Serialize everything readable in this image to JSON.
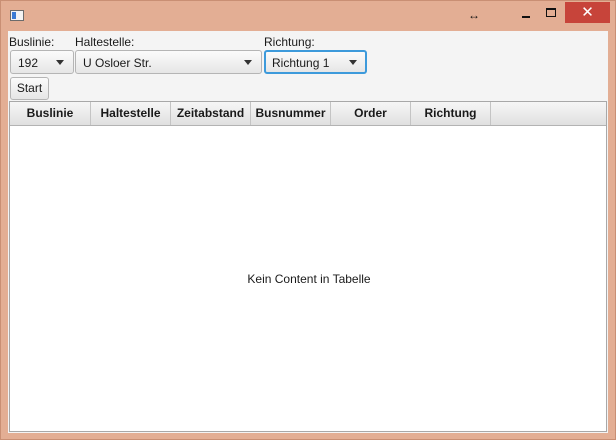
{
  "window": {
    "resize_glyph": "↔",
    "close_glyph": "✕",
    "colors": {
      "frame": "#e3ae94",
      "close": "#c7443a",
      "focus": "#3d9adb"
    }
  },
  "form": {
    "buslinie_label": "Buslinie:",
    "buslinie_value": "192",
    "haltestelle_label": "Haltestelle:",
    "haltestelle_value": "U Osloer Str.",
    "richtung_label": "Richtung:",
    "richtung_value": "Richtung 1",
    "start_button": "Start"
  },
  "table": {
    "columns": [
      "Buslinie",
      "Haltestelle",
      "Zeitabstand",
      "Busnummer",
      "Order",
      "Richtung"
    ],
    "placeholder": "Kein Content in Tabelle"
  }
}
